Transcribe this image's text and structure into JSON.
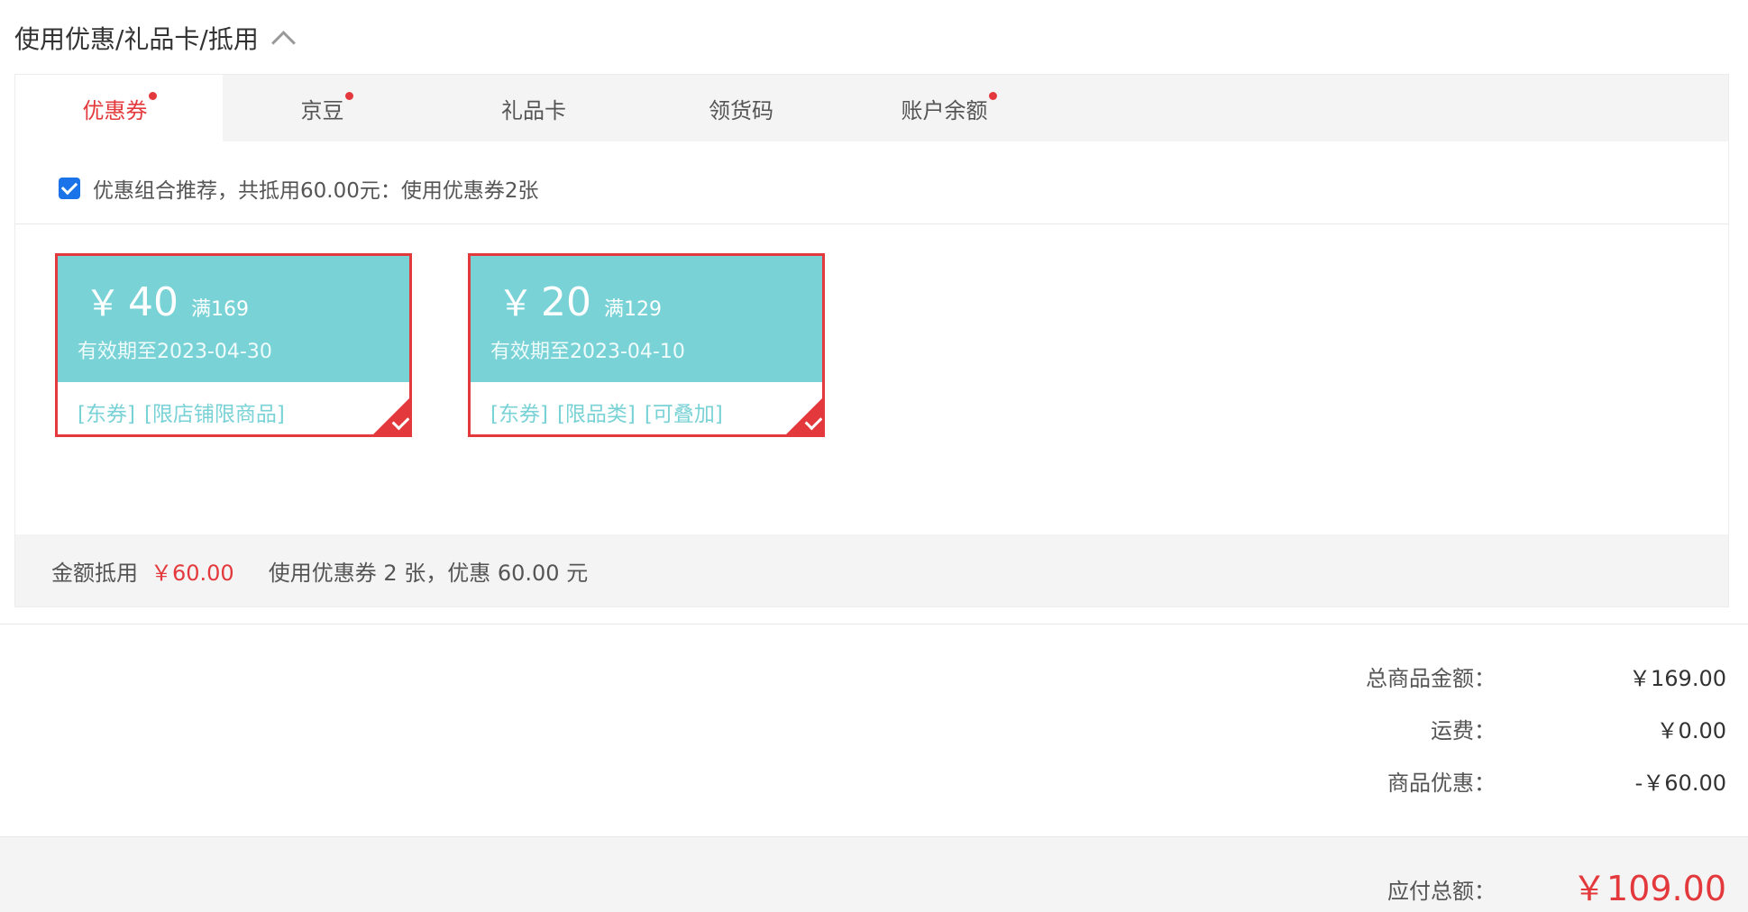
{
  "header": {
    "title": "使用优惠/礼品卡/抵用"
  },
  "tabs": [
    {
      "label": "优惠券",
      "active": true,
      "dot": true
    },
    {
      "label": "京豆",
      "active": false,
      "dot": true
    },
    {
      "label": "礼品卡",
      "active": false,
      "dot": false
    },
    {
      "label": "领货码",
      "active": false,
      "dot": false
    },
    {
      "label": "账户余额",
      "active": false,
      "dot": true
    }
  ],
  "combo": {
    "checked": true,
    "text": "优惠组合推荐，共抵用60.00元：使用优惠券2张"
  },
  "coupons": [
    {
      "symbol": "￥",
      "value": "40",
      "condition": "满169",
      "validity": "有效期至2023-04-30",
      "tags": [
        "[东券]",
        "[限店铺限商品]"
      ]
    },
    {
      "symbol": "￥",
      "value": "20",
      "condition": "满129",
      "validity": "有效期至2023-04-10",
      "tags": [
        "[东券]",
        "[限品类]",
        "[可叠加]"
      ]
    }
  ],
  "summary": {
    "label": "金额抵用",
    "amount": "￥60.00",
    "detail": "使用优惠券 2 张，优惠 60.00 元"
  },
  "totals": [
    {
      "label": "总商品金额：",
      "value": "￥169.00"
    },
    {
      "label": "运费：",
      "value": "￥0.00"
    },
    {
      "label": "商品优惠：",
      "value": "-￥60.00"
    }
  ],
  "payable": {
    "label": "应付总额：",
    "value": "￥109.00"
  },
  "colors": {
    "accent": "#e4393c",
    "coupon": "#79d2d6",
    "tabBg": "#f4f4f4"
  }
}
